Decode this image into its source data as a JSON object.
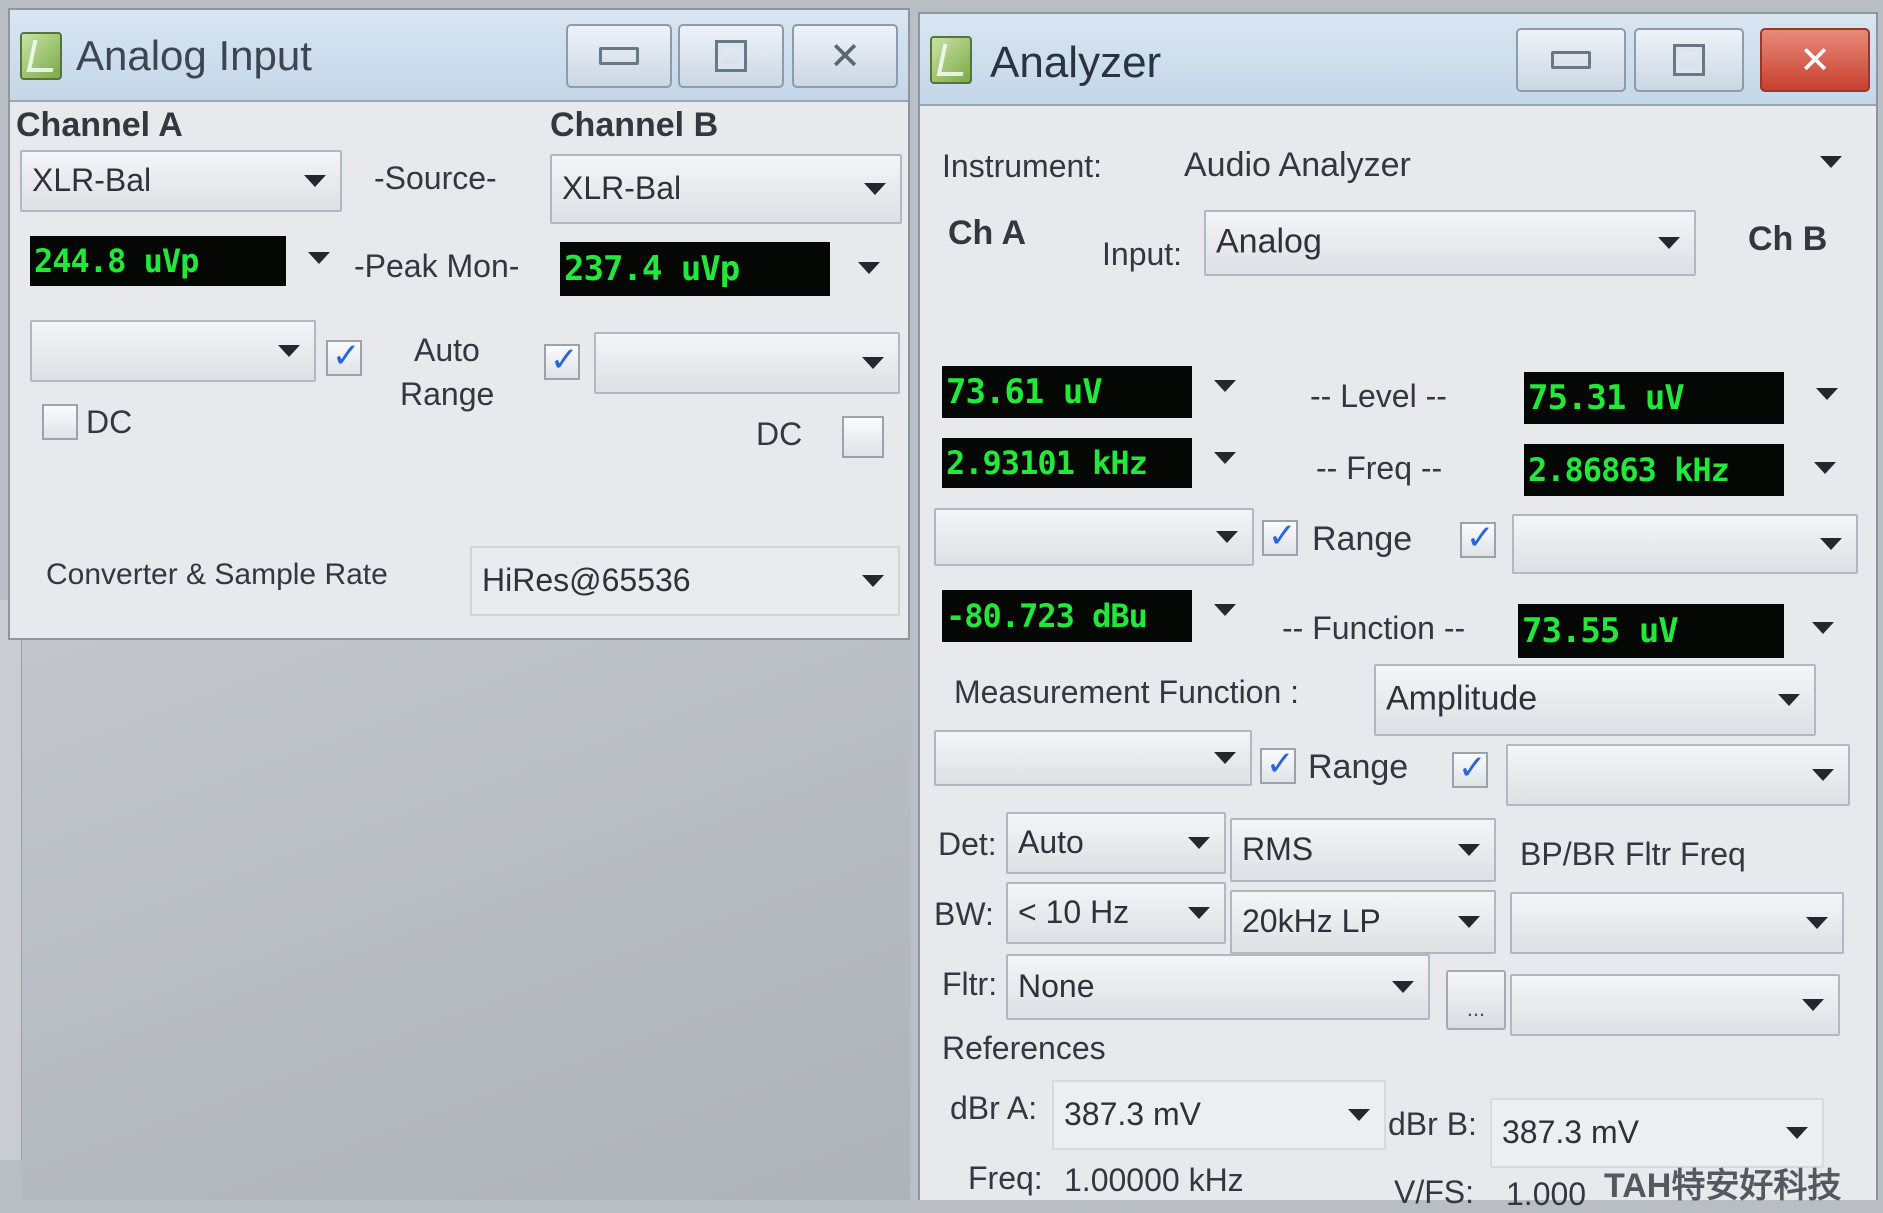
{
  "analog_input": {
    "title": "Analog Input",
    "channel_a_label": "Channel A",
    "channel_b_label": "Channel B",
    "source_label": "-Source-",
    "source_a": "XLR-Bal",
    "source_b": "XLR-Bal",
    "peak_mon_label": "-Peak Mon-",
    "peak_a": "244.8   uVp",
    "peak_b": "237.4   uVp",
    "range_a": "",
    "range_b": "",
    "auto_range_line1": "Auto",
    "auto_range_line2": "Range",
    "auto_range_a_checked": true,
    "auto_range_b_checked": true,
    "dc_label": "DC",
    "dc_a_checked": false,
    "dc_b_checked": false,
    "converter_label": "Converter & Sample Rate",
    "converter_value": "HiRes@65536"
  },
  "analyzer": {
    "title": "Analyzer",
    "instrument_label": "Instrument:",
    "instrument_value": "Audio Analyzer",
    "ch_a_label": "Ch A",
    "ch_b_label": "Ch B",
    "input_label": "Input:",
    "input_value": "Analog",
    "level_label": "-- Level --",
    "level_a": "73.61   uV",
    "level_b": "75.31   uV",
    "freq_label": "-- Freq --",
    "freq_a": "2.93101 kHz",
    "freq_b": "2.86863 kHz",
    "range_label": "Range",
    "range1_a_checked": true,
    "range1_b_checked": true,
    "function_label": "-- Function --",
    "function_a": "-80.723  dBu",
    "function_b": "73.55   uV",
    "measurement_function_label": "Measurement Function :",
    "measurement_function_value": "Amplitude",
    "range2_a_checked": true,
    "range2_b_checked": true,
    "det_label": "Det:",
    "det_value": "Auto",
    "det_type": "RMS",
    "bw_label": "BW:",
    "bw_value": "< 10 Hz",
    "bw_filter": "20kHz LP",
    "bpbr_label": "BP/BR Fltr Freq",
    "fltr_label": "Fltr:",
    "fltr_value": "None",
    "ellipsis": "...",
    "references_label": "References",
    "dbr_a_label": "dBr A:",
    "dbr_a_value": "387.3     mV",
    "dbr_b_label": "dBr B:",
    "dbr_b_value": "387.3     mV",
    "ref_freq_label": "Freq:",
    "ref_freq_value": "1.00000 kHz",
    "vfs_label": "V/FS:",
    "vfs_value": "1.000"
  },
  "watermark": "TAH特安好科技"
}
